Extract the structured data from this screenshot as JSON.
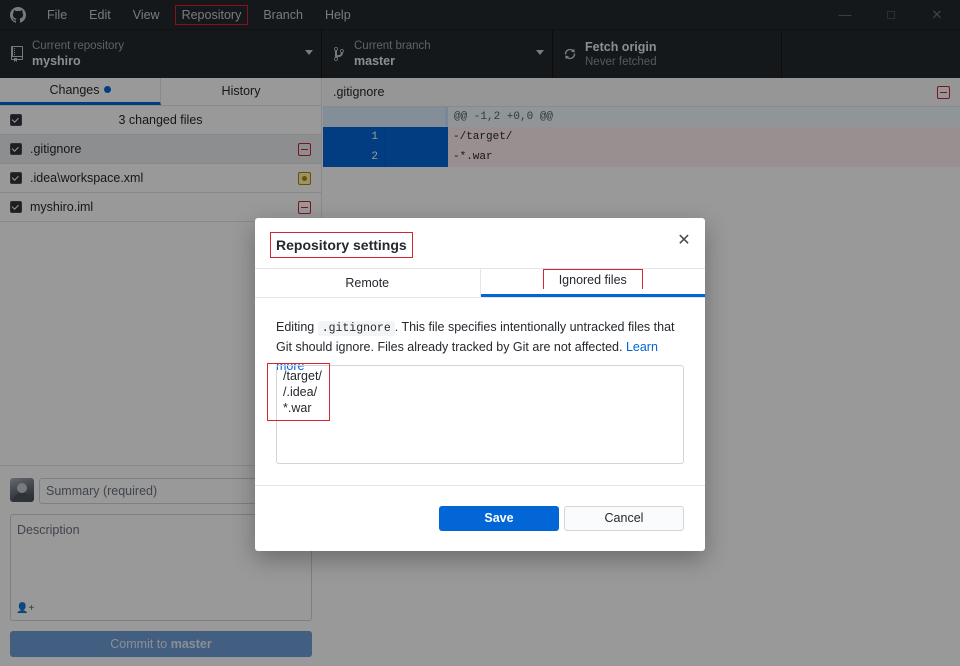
{
  "menu": [
    "File",
    "Edit",
    "View",
    "Repository",
    "Branch",
    "Help"
  ],
  "toolbar": {
    "repo_label": "Current repository",
    "repo_value": "myshiro",
    "branch_label": "Current branch",
    "branch_value": "master",
    "fetch_title": "Fetch origin",
    "fetch_sub": "Never fetched"
  },
  "sidebar": {
    "tab_changes": "Changes",
    "tab_history": "History",
    "changed_count": "3 changed files",
    "files": [
      {
        "name": ".gitignore",
        "status": "deleted"
      },
      {
        "name": ".idea\\workspace.xml",
        "status": "modified"
      },
      {
        "name": "myshiro.iml",
        "status": "deleted"
      }
    ],
    "summary_placeholder": "Summary (required)",
    "description_placeholder": "Description",
    "commit_prefix": "Commit to ",
    "commit_branch": "master"
  },
  "diff": {
    "file": ".gitignore",
    "hunk": "@@ -1,2 +0,0 @@",
    "lines": [
      {
        "old": "1",
        "code": "-/target/"
      },
      {
        "old": "2",
        "code": "-*.war"
      }
    ]
  },
  "dialog": {
    "title": "Repository settings",
    "tab_remote": "Remote",
    "tab_ignored": "Ignored files",
    "body_pre": "Editing ",
    "body_code": ".gitignore",
    "body_post": ". This file specifies intentionally untracked files that Git should ignore. Files already tracked by Git are not affected. ",
    "link": "Learn more",
    "ignore_lines": [
      "/target/",
      "/.idea/",
      "*.war"
    ],
    "save_label": "Save",
    "cancel_label": "Cancel"
  },
  "colors": {
    "accent": "#0366d6",
    "highlight_box": "#d4262f",
    "titlebar": "#24292e"
  }
}
